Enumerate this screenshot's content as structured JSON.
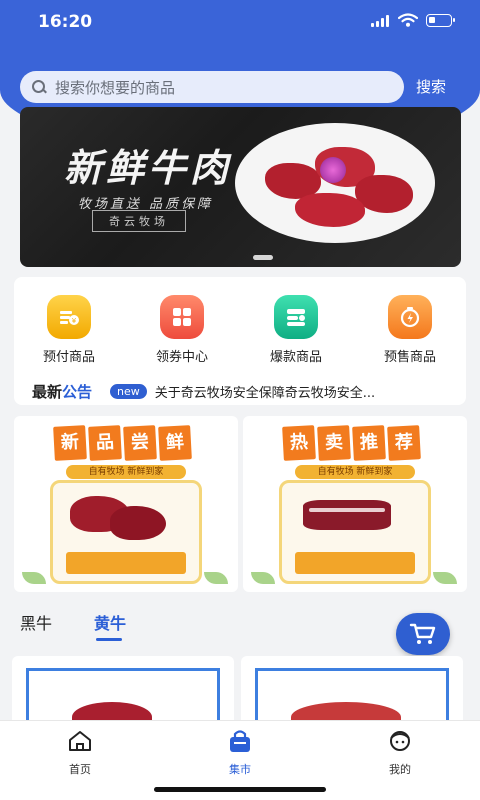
{
  "status_bar": {
    "time": "16:20"
  },
  "search": {
    "placeholder": "搜索你想要的商品",
    "button_label": "搜索"
  },
  "banner": {
    "title": "新鲜牛肉",
    "subtitle": "牧场直送 品质保障",
    "tag": "奇云牧场"
  },
  "categories": [
    {
      "label": "预付商品",
      "icon": "prepaid-icon",
      "color": "#f5b316"
    },
    {
      "label": "领券中心",
      "icon": "coupon-center-icon",
      "color": "#f2624a"
    },
    {
      "label": "爆款商品",
      "icon": "hot-product-icon",
      "color": "#1fc59a"
    },
    {
      "label": "预售商品",
      "icon": "presale-icon",
      "color": "#f78a2a"
    }
  ],
  "notice": {
    "title_prefix": "最新",
    "title_accent": "公告",
    "badge": "new",
    "text": "关于奇云牧场安全保障奇云牧场安全..."
  },
  "promos": [
    {
      "title_chars": [
        "新",
        "品",
        "尝",
        "鲜"
      ],
      "subline": "自有牧场 新鲜到家"
    },
    {
      "title_chars": [
        "热",
        "卖",
        "推",
        "荐"
      ],
      "subline": "自有牧场 新鲜到家"
    }
  ],
  "tabs": [
    {
      "label": "黑牛",
      "active": false
    },
    {
      "label": "黄牛",
      "active": true
    }
  ],
  "bottom_nav": [
    {
      "label": "首页",
      "icon": "home-icon",
      "active": false
    },
    {
      "label": "集市",
      "icon": "market-bag-icon",
      "active": true
    },
    {
      "label": "我的",
      "icon": "profile-icon",
      "active": false
    }
  ],
  "colors": {
    "primary": "#3a64d8",
    "accent_blue": "#2b5fd6",
    "promo_orange": "#f27b1e"
  }
}
